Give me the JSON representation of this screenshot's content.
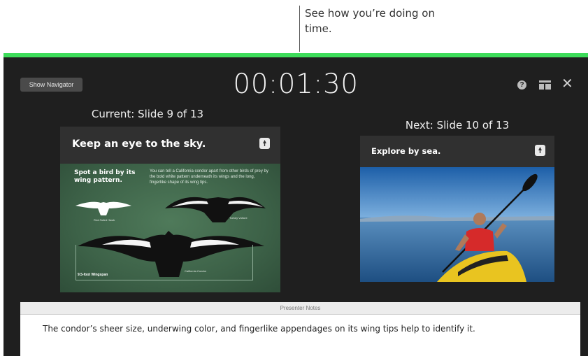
{
  "callout": {
    "text": "See how you’re doing on time."
  },
  "toolbar": {
    "show_navigator_label": "Show Navigator",
    "timer": "00:01:30",
    "help_glyph": "?",
    "close_glyph": "✕"
  },
  "icons": [
    "help-icon",
    "layout-icon",
    "close-icon"
  ],
  "current": {
    "label": "Current: Slide 9 of 13",
    "title": "Keep an eye to the sky.",
    "subhead": "Spot a bird by its wing pattern.",
    "description": "You can tell a California condor apart from other birds of prey by the bold white pattern underneath its wings and the long, fingerlike shape of its wing tips.",
    "bird_labels": [
      "Red-Tailed Hawk",
      "Turkey Vulture",
      "California Condor"
    ],
    "wingspan_label": "9.5-foot Wingspan"
  },
  "next": {
    "label": "Next: Slide 10 of 13",
    "title": "Explore by sea."
  },
  "notes": {
    "header": "Presenter Notes",
    "text": "The condor’s sheer size, underwing color, and fingerlike appendages on its wing tips help to identify it."
  },
  "colors": {
    "accent": "#3ddc5a",
    "background": "#1f1f1f",
    "slide_green": "#3d6248"
  }
}
